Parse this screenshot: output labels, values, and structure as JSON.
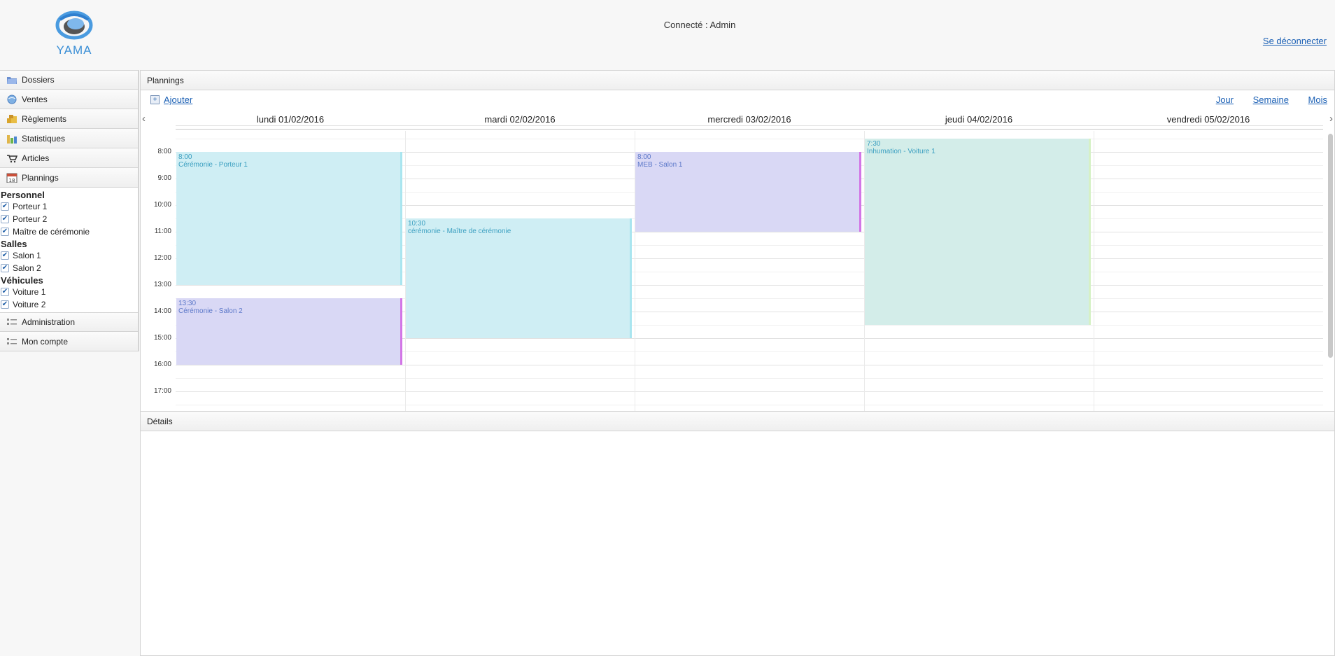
{
  "header": {
    "logo_text": "YAMA",
    "user_label": "Connecté : Admin",
    "logout_label": "Se déconnecter"
  },
  "sidebar": {
    "items": [
      {
        "label": "Dossiers",
        "icon": "folder-icon"
      },
      {
        "label": "Ventes",
        "icon": "globe-icon"
      },
      {
        "label": "Règlements",
        "icon": "coins-icon"
      },
      {
        "label": "Statistiques",
        "icon": "bar-chart-icon"
      },
      {
        "label": "Articles",
        "icon": "cart-icon"
      },
      {
        "label": "Plannings",
        "icon": "calendar-icon"
      }
    ],
    "filters": [
      {
        "group": "Personnel",
        "items": [
          "Porteur 1",
          "Porteur 2",
          "Maître de cérémonie"
        ]
      },
      {
        "group": "Salles",
        "items": [
          "Salon 1",
          "Salon 2"
        ]
      },
      {
        "group": "Véhicules",
        "items": [
          "Voiture 1",
          "Voiture 2"
        ]
      }
    ],
    "bottom_items": [
      {
        "label": "Administration",
        "icon": "settings-list-icon"
      },
      {
        "label": "Mon compte",
        "icon": "settings-list-icon"
      }
    ]
  },
  "plannings": {
    "title": "Plannings",
    "add_label": "Ajouter",
    "views": [
      "Jour",
      "Semaine",
      "Mois"
    ],
    "days": [
      "lundi 01/02/2016",
      "mardi 02/02/2016",
      "mercredi 03/02/2016",
      "jeudi 04/02/2016",
      "vendredi 05/02/2016"
    ],
    "hours": [
      "8:00",
      "9:00",
      "10:00",
      "11:00",
      "12:00",
      "13:00",
      "14:00",
      "15:00",
      "16:00",
      "17:00"
    ],
    "events": [
      {
        "day": 0,
        "start": "8:00",
        "end": "13:00",
        "time": "8:00",
        "title": "Cérémonie - Porteur 1",
        "color": "blue"
      },
      {
        "day": 0,
        "start": "13:30",
        "end": "16:00",
        "time": "13:30",
        "title": "Cérémonie - Salon 2",
        "color": "purple"
      },
      {
        "day": 1,
        "start": "10:30",
        "end": "15:00",
        "time": "10:30",
        "title": "cérémonie - Maître de cérémonie",
        "color": "blue"
      },
      {
        "day": 2,
        "start": "8:00",
        "end": "11:00",
        "time": "8:00",
        "title": "MEB - Salon 1",
        "color": "purple"
      },
      {
        "day": 3,
        "start": "7:30",
        "end": "14:30",
        "time": "7:30",
        "title": "Inhumation - Voiture 1",
        "color": "green"
      }
    ],
    "colors": {
      "blue": "#cfeef4",
      "purple": "#d9d8f5",
      "green": "#d3ede9"
    }
  },
  "details": {
    "title": "Détails"
  }
}
